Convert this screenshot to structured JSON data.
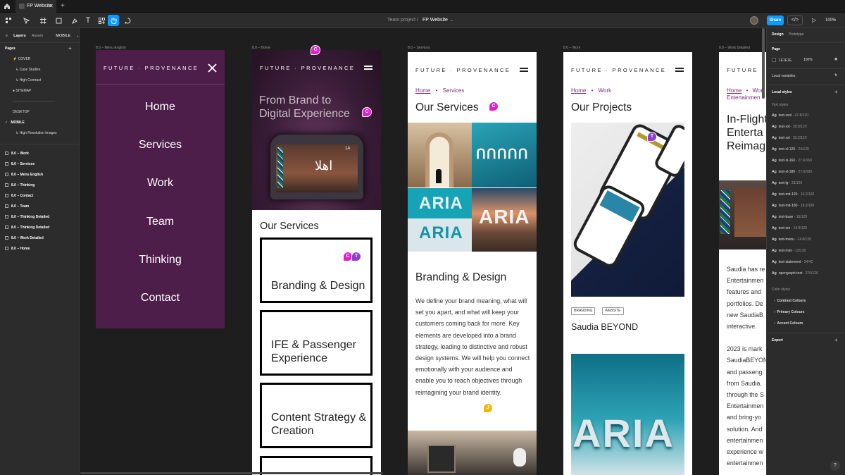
{
  "tab": {
    "file_name": "FP Website"
  },
  "toolbar": {
    "project": "Team project",
    "separator": "/",
    "file": "FP Website",
    "share": "Share",
    "zoom": "100%"
  },
  "left_panel": {
    "tabs": [
      "Layers",
      "Assets",
      "MOBILE"
    ],
    "pages_title": "Pages",
    "pages": [
      "COVER",
      "Case Studies",
      "High Contrast",
      "SITEMAP",
      "------------------------------------",
      "DESKTOP",
      "MOBILE",
      "High Resolution Images"
    ],
    "layers": [
      "8.0 – Work",
      "8.0 – Services",
      "8.0 – Menu English",
      "8.0 – Thinking",
      "8.0 – Contact",
      "8.0 – Team",
      "8.0 – Thinking Detailed",
      "8.0 – Thinking Detailed",
      "8.0 – Work Detailed",
      "8.0 – Home"
    ]
  },
  "right_panel": {
    "tabs": [
      "Design",
      "Prototype"
    ],
    "page_title": "Page",
    "page_color": "1E1E1E",
    "page_opacity": "100%",
    "local_variables": "Local variables",
    "local_styles": "Local styles",
    "text_styles_title": "Text styles",
    "text_styles": [
      {
        "glyph": "Ag",
        "name": "text-xxxl",
        "spec": "47.8/120"
      },
      {
        "glyph": "Ag",
        "name": "text-xxl",
        "spec": "39.8/120"
      },
      {
        "glyph": "Ag",
        "name": "text-xxl",
        "spec": "33.2/120"
      },
      {
        "glyph": "Ag",
        "name": "text-xl-120",
        "spec": "24/120"
      },
      {
        "glyph": "Ag",
        "name": "text-xl-160",
        "spec": "27.6/160"
      },
      {
        "glyph": "Ag",
        "name": "text-xl-180",
        "spec": "27.6/180"
      },
      {
        "glyph": "Ag",
        "name": "text-lg",
        "spec": "23/120"
      },
      {
        "glyph": "Ag",
        "name": "text-md-120",
        "spec": "19.2/120"
      },
      {
        "glyph": "Ag",
        "name": "text-md-180",
        "spec": "19.2/180"
      },
      {
        "glyph": "Ag",
        "name": "text-base",
        "spec": "16/120"
      },
      {
        "glyph": "Ag",
        "name": "text-sm",
        "spec": "14.9/120"
      },
      {
        "glyph": "Ag",
        "name": "text-menu",
        "spec": "14.8/120"
      },
      {
        "glyph": "Ag",
        "name": "text-mini",
        "spec": "12/120"
      },
      {
        "glyph": "Ag",
        "name": "text-statement",
        "spec": "24/42"
      },
      {
        "glyph": "Ag",
        "name": "opengraph-text",
        "spec": "270/120"
      }
    ],
    "color_styles_title": "Color styles",
    "color_styles": [
      "Contrast Colours",
      "Primary Colours",
      "Accent Colours"
    ],
    "export": "Export",
    "help": "?"
  },
  "frames": {
    "menu": {
      "label": "8.0 – Menu English",
      "logo": "FUTURE · PROVENANCE",
      "items": [
        "Home",
        "Services",
        "Work",
        "Team",
        "Thinking",
        "Contact"
      ]
    },
    "home": {
      "label": "8.0 – Home",
      "logo": "FUTURE · PROVENANCE",
      "hero": "From Brand to Digital Experience",
      "screen_code": "1A",
      "section_title": "Our Services",
      "services": [
        "Branding & Design",
        "IFE & Passenger Experience",
        "Content Strategy & Creation"
      ]
    },
    "services": {
      "label": "8.0 – Services",
      "logo": "FUTURE · PROVENANCE",
      "breadcrumb_home": "Home",
      "breadcrumb_sep": "•",
      "breadcrumb_current": "Services",
      "title": "Our Services",
      "aria_1": "ARIA",
      "aria_2": "ARIA",
      "aria_3": "ARIA",
      "subtitle": "Branding & Design",
      "body": "We define your brand meaning, what will set you apart, and what will keep your customers coming back for more. Key elements are developed into a brand strategy, leading to distinctive and robust design systems. We will help you connect emotionally with your audience and enable you to reach objectives through reimagining your brand identity."
    },
    "work": {
      "label": "8.0 – Work",
      "logo": "FUTURE · PROVENANCE",
      "breadcrumb_home": "Home",
      "breadcrumb_sep": "•",
      "breadcrumb_current": "Work",
      "title": "Our Projects",
      "tags": [
        "BRANDING",
        "WEBSITE"
      ],
      "project": "Saudia BEYOND",
      "aria": "ARIA"
    },
    "work_detailed": {
      "label": "8.0 – Work Detailed",
      "logo": "FUTURE",
      "breadcrumb_home": "Home",
      "breadcrumb_sep": "•",
      "breadcrumb_current": "Wor",
      "breadcrumb_line2": "Entertainmen",
      "title_lines": [
        "In-Flight",
        "Enterta",
        "Reimag"
      ],
      "body_lines": [
        "Saudia has re",
        "Entertainmen",
        "features and",
        "portfolios. De",
        "new SaudiaB",
        "interactive.",
        "",
        "2023 is mark",
        "SaudiaBEYON",
        "and passeng",
        "from Saudia.",
        "through the S",
        "Entertainmen",
        "and bring-yo",
        "solution. And",
        "entertainmen",
        "experience w",
        "entertainmen"
      ]
    }
  },
  "cursors": [
    "C",
    "C",
    "C",
    "T",
    "C",
    "T",
    "J"
  ],
  "colors": {
    "accent": "#0d99ff",
    "menu_bg": "#4e1e4b",
    "breadcrumb": "#7a2f78",
    "cursor_magenta": "#e020d0",
    "cursor_purple": "#8a3fd0",
    "cursor_yellow": "#f2b705"
  }
}
